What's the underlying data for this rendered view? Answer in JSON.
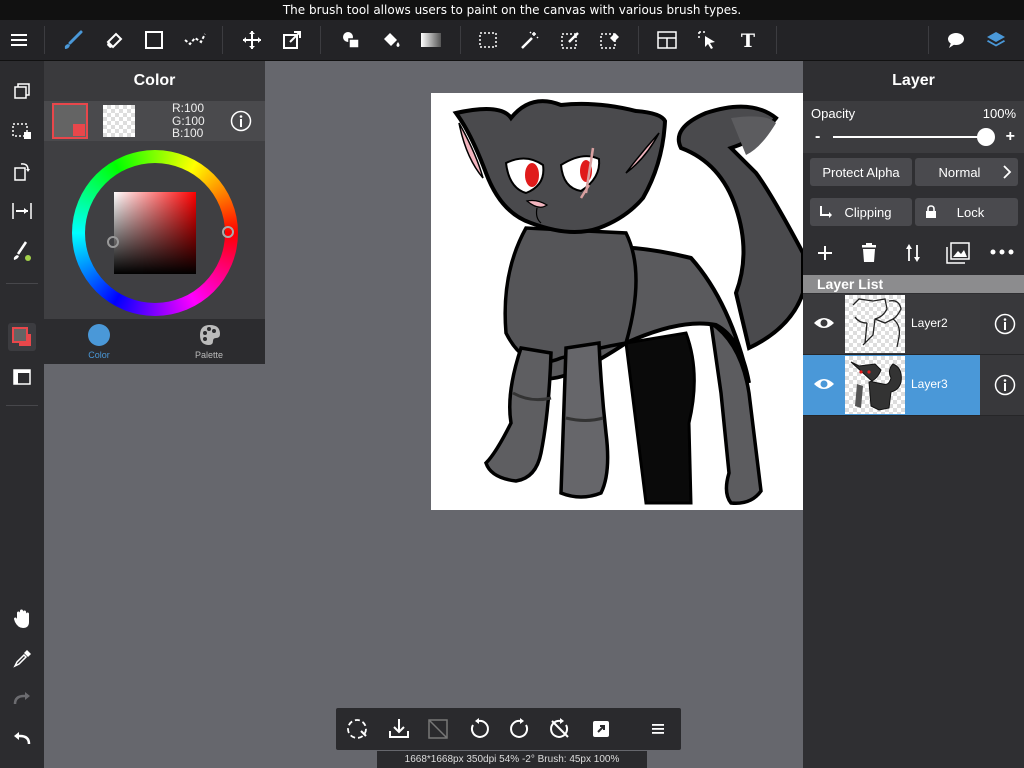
{
  "tooltip": "The brush tool allows users to paint on the canvas with various brush types.",
  "toolbar": {
    "icons": [
      "menu-icon",
      "brush-icon",
      "eraser-icon",
      "shape-icon",
      "snap-icon",
      "move-icon",
      "transform-icon",
      "fill-shape-icon",
      "bucket-icon",
      "gradient-icon",
      "select-rect-icon",
      "magic-wand-icon",
      "select-pen-icon",
      "select-eraser-icon",
      "layout-icon",
      "select-move-icon",
      "text-icon",
      "speech-icon",
      "layers-icon"
    ],
    "active": "brush-icon",
    "accent": "#4a98d8"
  },
  "color_panel": {
    "title": "Color",
    "primary_color": "#646464",
    "r": "R:100",
    "g": "G:100",
    "b": "B:100",
    "tabs": {
      "color": "Color",
      "palette": "Palette"
    }
  },
  "layer_panel": {
    "title": "Layer",
    "opacity_label": "Opacity",
    "opacity_value": "100%",
    "opacity_fraction": 1.0,
    "minus": "-",
    "plus": "+",
    "protect_alpha": "Protect Alpha",
    "blend_mode": "Normal",
    "clipping": "Clipping",
    "lock": "Lock",
    "list_header": "Layer List",
    "layers": [
      {
        "name": "Layer2",
        "selected": false
      },
      {
        "name": "Layer3",
        "selected": true
      }
    ]
  },
  "status": "1668*1668px 350dpi 54% -2° Brush: 45px 100%"
}
